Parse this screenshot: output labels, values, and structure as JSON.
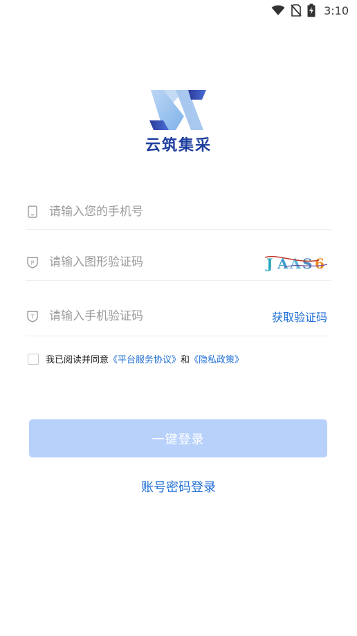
{
  "status_bar": {
    "time": "3:10",
    "icons": [
      "wifi-icon",
      "no-sim-icon",
      "battery-charging-icon"
    ]
  },
  "logo": {
    "text": "云筑集采",
    "icon": "logo-mark"
  },
  "form": {
    "phone": {
      "icon": "phone-icon",
      "placeholder": "请输入您的手机号",
      "value": ""
    },
    "captcha": {
      "icon": "parking-shield-icon",
      "placeholder": "请输入图形验证码",
      "value": "",
      "image_text": "JAAS6"
    },
    "sms": {
      "icon": "t-shield-icon",
      "placeholder": "请输入手机验证码",
      "value": "",
      "get_code_label": "获取验证码"
    }
  },
  "agreement": {
    "checked": false,
    "prefix": "我已阅读并同意",
    "terms_link": "《平台服务协议》",
    "conjunction": "和",
    "privacy_link": "《隐私政策》"
  },
  "login_button": {
    "label": "一键登录"
  },
  "password_login": {
    "label": "账号密码登录"
  },
  "colors": {
    "accent": "#1f6fd6",
    "button_disabled": "#b7d1fb",
    "logo_text": "#1f3f9e"
  }
}
